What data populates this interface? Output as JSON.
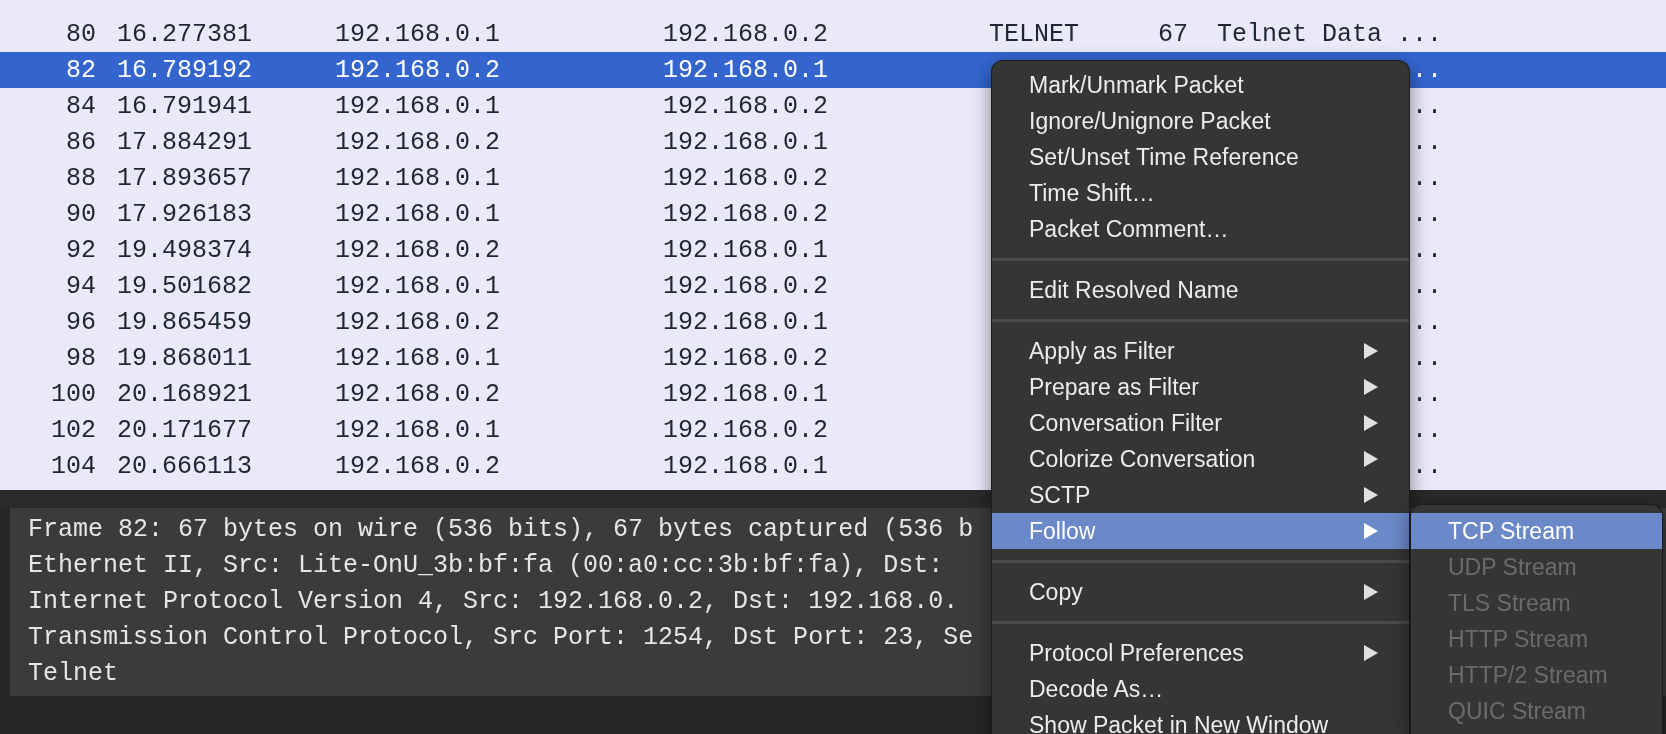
{
  "packet_list": {
    "rows": [
      {
        "no": "80",
        "time": "16.277381",
        "source": "192.168.0.1",
        "destination": "192.168.0.2",
        "protocol": "TELNET",
        "length": "67",
        "info": "Telnet Data ...",
        "selected": false
      },
      {
        "no": "82",
        "time": "16.789192",
        "source": "192.168.0.2",
        "destination": "192.168.0.1",
        "info": "..",
        "selected": true
      },
      {
        "no": "84",
        "time": "16.791941",
        "source": "192.168.0.1",
        "destination": "192.168.0.2",
        "info": "..",
        "selected": false
      },
      {
        "no": "86",
        "time": "17.884291",
        "source": "192.168.0.2",
        "destination": "192.168.0.1",
        "info": "..",
        "selected": false
      },
      {
        "no": "88",
        "time": "17.893657",
        "source": "192.168.0.1",
        "destination": "192.168.0.2",
        "info": "..",
        "selected": false
      },
      {
        "no": "90",
        "time": "17.926183",
        "source": "192.168.0.1",
        "destination": "192.168.0.2",
        "info": "..",
        "selected": false
      },
      {
        "no": "92",
        "time": "19.498374",
        "source": "192.168.0.2",
        "destination": "192.168.0.1",
        "info": "..",
        "selected": false
      },
      {
        "no": "94",
        "time": "19.501682",
        "source": "192.168.0.1",
        "destination": "192.168.0.2",
        "info": "..",
        "selected": false
      },
      {
        "no": "96",
        "time": "19.865459",
        "source": "192.168.0.2",
        "destination": "192.168.0.1",
        "info": "..",
        "selected": false
      },
      {
        "no": "98",
        "time": "19.868011",
        "source": "192.168.0.1",
        "destination": "192.168.0.2",
        "info": "..",
        "selected": false
      },
      {
        "no": "100",
        "time": "20.168921",
        "source": "192.168.0.2",
        "destination": "192.168.0.1",
        "info": "..",
        "selected": false
      },
      {
        "no": "102",
        "time": "20.171677",
        "source": "192.168.0.1",
        "destination": "192.168.0.2",
        "info": "..",
        "selected": false
      },
      {
        "no": "104",
        "time": "20.666113",
        "source": "192.168.0.2",
        "destination": "192.168.0.1",
        "info": "..",
        "selected": false
      }
    ]
  },
  "packet_details": {
    "lines": [
      "Frame 82: 67 bytes on wire (536 bits), 67 bytes captured (536 b",
      "Ethernet II, Src: Lite-OnU_3b:bf:fa (00:a0:cc:3b:bf:fa), Dst:",
      "Internet Protocol Version 4, Src: 192.168.0.2, Dst: 192.168.0.",
      "Transmission Control Protocol, Src Port: 1254, Dst Port: 23, Se",
      "Telnet"
    ]
  },
  "context_menu": {
    "groups": [
      [
        {
          "label": "Mark/Unmark Packet",
          "submenu": false,
          "selected": false
        },
        {
          "label": "Ignore/Unignore Packet",
          "submenu": false,
          "selected": false
        },
        {
          "label": "Set/Unset Time Reference",
          "submenu": false,
          "selected": false
        },
        {
          "label": "Time Shift…",
          "submenu": false,
          "selected": false
        },
        {
          "label": "Packet Comment…",
          "submenu": false,
          "selected": false
        }
      ],
      [
        {
          "label": "Edit Resolved Name",
          "submenu": false,
          "selected": false
        }
      ],
      [
        {
          "label": "Apply as Filter",
          "submenu": true,
          "selected": false
        },
        {
          "label": "Prepare as Filter",
          "submenu": true,
          "selected": false
        },
        {
          "label": "Conversation Filter",
          "submenu": true,
          "selected": false
        },
        {
          "label": "Colorize Conversation",
          "submenu": true,
          "selected": false
        },
        {
          "label": "SCTP",
          "submenu": true,
          "selected": false
        },
        {
          "label": "Follow",
          "submenu": true,
          "selected": true
        }
      ],
      [
        {
          "label": "Copy",
          "submenu": true,
          "selected": false
        }
      ],
      [
        {
          "label": "Protocol Preferences",
          "submenu": true,
          "selected": false
        },
        {
          "label": "Decode As…",
          "submenu": false,
          "selected": false
        },
        {
          "label": "Show Packet in New Window",
          "submenu": false,
          "selected": false
        }
      ]
    ]
  },
  "submenu": {
    "items": [
      {
        "label": "TCP Stream",
        "selected": true,
        "disabled": false
      },
      {
        "label": "UDP Stream",
        "selected": false,
        "disabled": true
      },
      {
        "label": "TLS Stream",
        "selected": false,
        "disabled": true
      },
      {
        "label": "HTTP Stream",
        "selected": false,
        "disabled": true
      },
      {
        "label": "HTTP/2 Stream",
        "selected": false,
        "disabled": true
      },
      {
        "label": "QUIC Stream",
        "selected": false,
        "disabled": true
      }
    ]
  }
}
